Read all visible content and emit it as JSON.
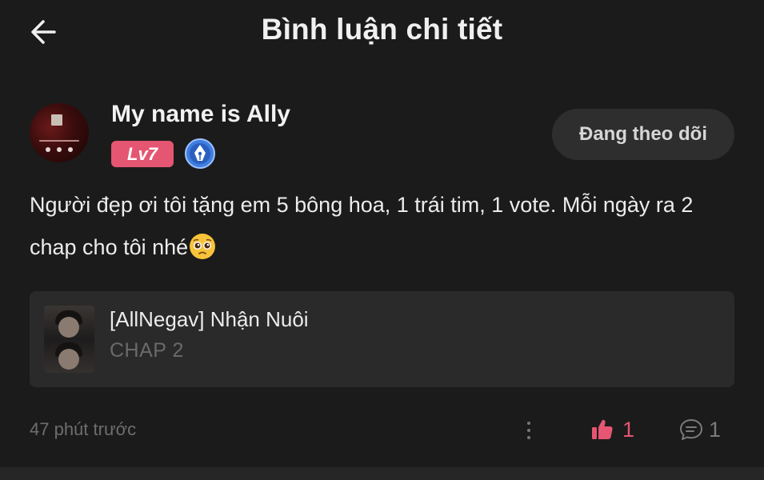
{
  "header": {
    "title": "Bình luận chi tiết",
    "back_icon": "arrow-left-icon"
  },
  "user": {
    "name": "My name is Ally",
    "level": "Lv7",
    "level_color": "#e45671",
    "badge_icon": "pen-nib-badge-icon",
    "badge_color": "#3f7de0"
  },
  "follow": {
    "label": "Đang theo dõi"
  },
  "comment": {
    "text": "Người đẹp ơi tôi tặng em 5 bông hoa, 1 trái tim, 1 vote. Mỗi ngày ra 2 chap cho tôi nhé",
    "emoji": "pleading-face-emoji"
  },
  "story": {
    "title": "[AllNegav] Nhận Nuôi",
    "chapter": "CHAP 2"
  },
  "footer": {
    "timestamp": "47 phút trước",
    "likes": "1",
    "replies": "1",
    "accent_color": "#e45671"
  }
}
